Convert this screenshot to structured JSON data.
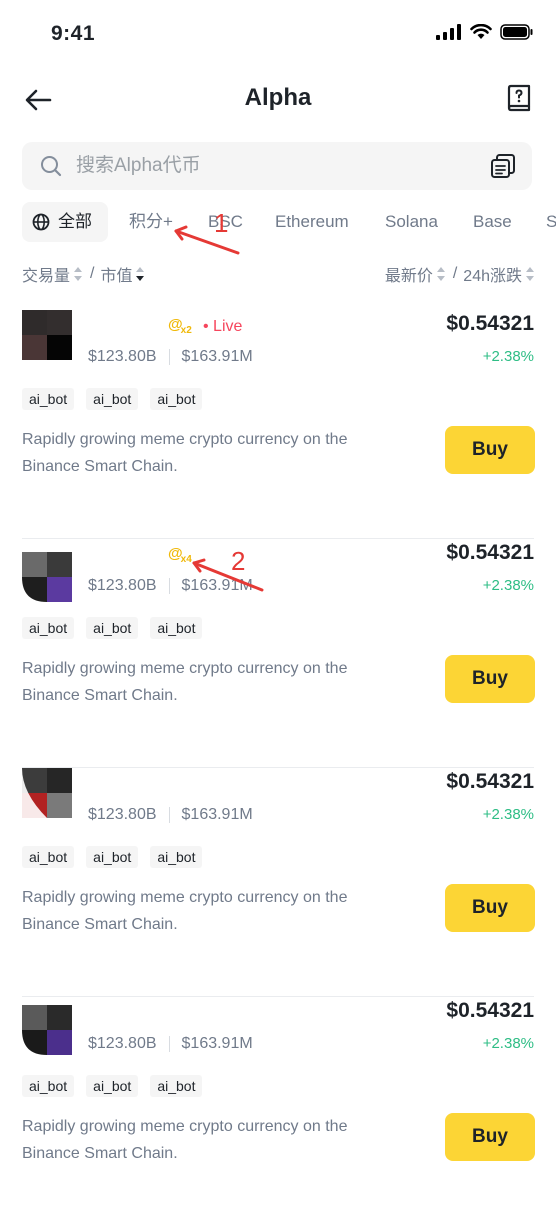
{
  "status_bar": {
    "time": "9:41"
  },
  "nav": {
    "title": "Alpha"
  },
  "search": {
    "placeholder": "搜索Alpha代币"
  },
  "tabs": [
    {
      "label": "全部"
    },
    {
      "label": "积分+"
    },
    {
      "label": "BSC"
    },
    {
      "label": "Ethereum"
    },
    {
      "label": "Solana"
    },
    {
      "label": "Base"
    },
    {
      "label": "S"
    }
  ],
  "sort": {
    "volume": "交易量",
    "sep1": "/",
    "market_cap": "市值",
    "last_price": "最新价",
    "sep2": "/",
    "change_24h": "24h涨跌"
  },
  "tokens": [
    {
      "volume": "$123.80B",
      "market_cap": "$163.91M",
      "price": "$0.54321",
      "change": "+2.38%",
      "badge_at": "@",
      "badge_mult": "x2",
      "live": "• Live",
      "tags": [
        "ai_bot",
        "ai_bot",
        "ai_bot"
      ],
      "description": "Rapidly growing meme crypto currency on the Binance Smart Chain.",
      "buy_label": "Buy"
    },
    {
      "volume": "$123.80B",
      "market_cap": "$163.91M",
      "price": "$0.54321",
      "change": "+2.38%",
      "badge_at": "@",
      "badge_mult": "x4",
      "tags": [
        "ai_bot",
        "ai_bot",
        "ai_bot"
      ],
      "description": "Rapidly growing meme crypto currency on the Binance Smart Chain.",
      "buy_label": "Buy"
    },
    {
      "volume": "$123.80B",
      "market_cap": "$163.91M",
      "price": "$0.54321",
      "change": "+2.38%",
      "tags": [
        "ai_bot",
        "ai_bot",
        "ai_bot"
      ],
      "description": "Rapidly growing meme crypto currency on the Binance Smart Chain.",
      "buy_label": "Buy"
    },
    {
      "volume": "$123.80B",
      "market_cap": "$163.91M",
      "price": "$0.54321",
      "change": "+2.38%",
      "tags": [
        "ai_bot",
        "ai_bot",
        "ai_bot"
      ],
      "description": "Rapidly growing meme crypto currency on the Binance Smart Chain.",
      "buy_label": "Buy"
    }
  ],
  "annotations": {
    "marker_1": "1",
    "marker_2": "2"
  },
  "colors": {
    "accent_yellow": "#fcd535",
    "positive": "#2ebd85",
    "live_red": "#f6465d",
    "annotation_red": "#e53935",
    "badge_gold": "#f0b90b"
  },
  "icons": [
    "back-arrow-icon",
    "help-book-icon",
    "search-icon",
    "copy-list-icon",
    "globe-icon",
    "signal-icon",
    "wifi-icon",
    "battery-icon",
    "sort-arrows-icon"
  ]
}
